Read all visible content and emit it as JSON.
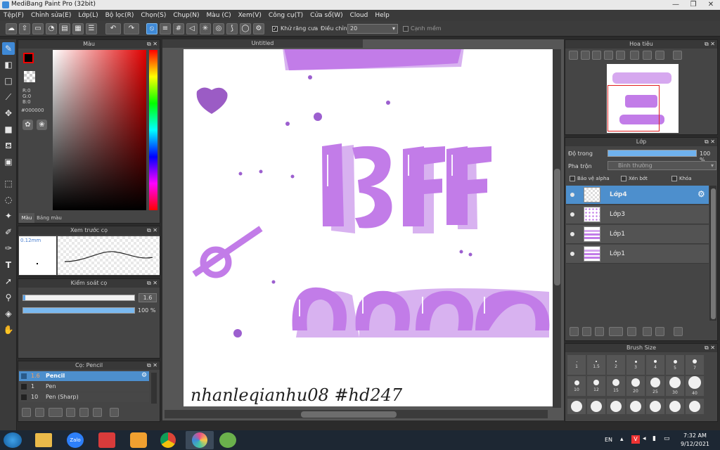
{
  "app": {
    "title": "MediBang Paint Pro (32bit)"
  },
  "menu": [
    "Tệp(F)",
    "Chỉnh sửa(E)",
    "Lớp(L)",
    "Bộ lọc(R)",
    "Chọn(S)",
    "Chụp(N)",
    "Màu (C)",
    "Xem(V)",
    "Công cụ(T)",
    "Cửa sổ(W)",
    "Cloud",
    "Help"
  ],
  "toolbar": {
    "antialias_label": "Khử răng cưa",
    "adjust_label": "Điều chỉnh",
    "adjust_value": "20",
    "smooth_label": "Cạnh mềm"
  },
  "color_panel": {
    "title": "Màu",
    "r": "R:0",
    "g": "G:0",
    "b": "B:0",
    "hex": "#000000",
    "tab_color": "Màu",
    "tab_palette": "Bảng màu"
  },
  "preview_panel": {
    "title": "Xem trước cọ",
    "size": "0.12mm"
  },
  "brush_control": {
    "title": "Kiểm soát cọ",
    "size_value": "1.6",
    "opacity_value": "100 %",
    "size_fill": 0.02,
    "opacity_fill": 1.0
  },
  "brush_list": {
    "title": "Cọ: Pencil",
    "items": [
      {
        "size": "1.6",
        "name": "Pencil"
      },
      {
        "size": "1",
        "name": "Pen"
      },
      {
        "size": "10",
        "name": "Pen (Sharp)"
      }
    ]
  },
  "document": {
    "tab": "Untitled",
    "signature": "nhanleqianhu08 #hd247",
    "bff": "BFF",
    "line3": "nam"
  },
  "navigator": {
    "title": "Hoa tiêu"
  },
  "layer_panel": {
    "title": "Lớp",
    "opacity_label": "Độ trong",
    "opacity_value": "100 %",
    "blend_label": "Pha trộn",
    "blend_value": "Bình thường",
    "protect_alpha": "Bảo vệ alpha",
    "clipping": "Xén bớt",
    "lock": "Khóa",
    "layers": [
      "Lớp4",
      "Lớp3",
      "Lớp1",
      "Lớp1"
    ],
    "opacity_fill": 1.0
  },
  "brush_size": {
    "title": "Brush Size",
    "row1": [
      "1",
      "1.5",
      "2",
      "3",
      "4",
      "5",
      "7"
    ],
    "row2": [
      "10",
      "12",
      "15",
      "20",
      "25",
      "30",
      "40"
    ]
  },
  "taskbar": {
    "lang": "EN",
    "time": "7:32 AM",
    "date": "9/12/2021"
  },
  "colors": {
    "accent": "#3f89d6",
    "paint": "#c27ce8",
    "paint_dark": "#8e55c9"
  }
}
